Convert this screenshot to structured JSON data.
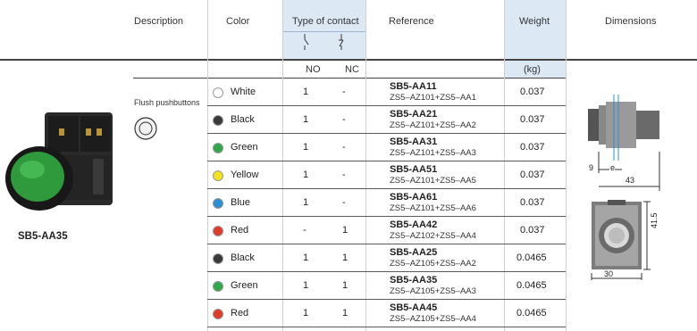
{
  "headers": {
    "description": "Description",
    "color": "Color",
    "type_of_contact": "Type of contact",
    "reference": "Reference",
    "weight": "Weight",
    "dimensions": "Dimensions",
    "no": "NO",
    "nc": "NC",
    "kg": "(kg)"
  },
  "product": {
    "name": "SB5-AA35",
    "subtitle": "Flush pushbuttons",
    "button_color": "#2f9a3c"
  },
  "rows": [
    {
      "color": "White",
      "swatch": "#ffffff",
      "no": "1",
      "nc": "-",
      "ref": "SB5-AA11",
      "sub": "ZS5–AZ101+ZS5–AA1",
      "weight": "0.037"
    },
    {
      "color": "Black",
      "swatch": "#3a3a3a",
      "no": "1",
      "nc": "-",
      "ref": "SB5-AA21",
      "sub": "ZS5–AZ101+ZS5–AA2",
      "weight": "0.037"
    },
    {
      "color": "Green",
      "swatch": "#2ea84a",
      "no": "1",
      "nc": "-",
      "ref": "SB5-AA31",
      "sub": "ZS5–AZ101+ZS5–AA3",
      "weight": "0.037"
    },
    {
      "color": "Yellow",
      "swatch": "#f3e11d",
      "no": "1",
      "nc": "-",
      "ref": "SB5-AA51",
      "sub": "ZS5–AZ101+ZS5–AA5",
      "weight": "0.037"
    },
    {
      "color": "Blue",
      "swatch": "#2b8fd8",
      "no": "1",
      "nc": "-",
      "ref": "SB5-AA61",
      "sub": "ZS5–AZ101+ZS5–AA6",
      "weight": "0.037"
    },
    {
      "color": "Red",
      "swatch": "#e03a2a",
      "no": "-",
      "nc": "1",
      "ref": "SB5-AA42",
      "sub": "ZS5–AZ102+ZS5–AA4",
      "weight": "0.037"
    },
    {
      "color": "Black",
      "swatch": "#3a3a3a",
      "no": "1",
      "nc": "1",
      "ref": "SB5-AA25",
      "sub": "ZS5–AZ105+ZS5–AA2",
      "weight": "0.0465"
    },
    {
      "color": "Green",
      "swatch": "#2ea84a",
      "no": "1",
      "nc": "1",
      "ref": "SB5-AA35",
      "sub": "ZS5–AZ105+ZS5–AA3",
      "weight": "0.0465"
    },
    {
      "color": "Red",
      "swatch": "#e03a2a",
      "no": "1",
      "nc": "1",
      "ref": "SB5-AA45",
      "sub": "ZS5–AZ105+ZS5–AA4",
      "weight": "0.0465"
    }
  ],
  "dimensions": {
    "dim_9": "9",
    "dim_e": "e",
    "dim_43": "43",
    "dim_41_5": "41.5",
    "dim_30": "30"
  },
  "colors": {
    "header_band": "#dce9f5",
    "rule": "#bdbdbd",
    "accent": "#2f9a3c"
  }
}
